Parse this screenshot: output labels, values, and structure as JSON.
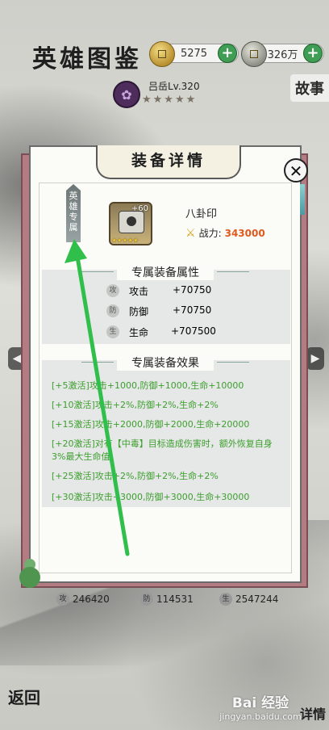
{
  "header": {
    "title": "英雄图鉴",
    "gold": "5275",
    "coins": "326万",
    "plus": "+",
    "story": "故事"
  },
  "hero": {
    "name": "吕岳Lv.320",
    "stars": "★★★★★"
  },
  "dialog": {
    "title": "装备详情",
    "close": "✕",
    "exclusive_tag": "英雄专属",
    "item": {
      "name": "八卦印",
      "level": "+60",
      "stars": "★★★★★",
      "power_label": "战力:",
      "power_value": "343000"
    },
    "attrs_header": "专属装备属性",
    "attrs": [
      {
        "icon": "攻",
        "name": "攻击",
        "value": "+70750"
      },
      {
        "icon": "防",
        "name": "防御",
        "value": "+70750"
      },
      {
        "icon": "生",
        "name": "生命",
        "value": "+707500"
      }
    ],
    "effects_header": "专属装备效果",
    "effects": [
      "[+5激活]攻击+1000,防御+1000,生命+10000",
      "[+10激活]攻击+2%,防御+2%,生命+2%",
      "[+15激活]攻击+2000,防御+2000,生命+20000",
      "[+20激活]对有【中毒】目标造成伤害时，额外恢复自身3%最大生命值",
      "[+25激活]攻击+2%,防御+2%,生命+2%",
      "[+30激活]攻击+3000,防御+3000,生命+30000"
    ]
  },
  "bottom_stats": {
    "attack": "246420",
    "defense": "114531",
    "hp": "2547244"
  },
  "nav": {
    "back": "返回",
    "detail": "详情",
    "left_arrow": "◀",
    "right_arrow": "▶"
  },
  "watermark": {
    "main": "Bai 经验",
    "sub": "jingyan.baidu.com"
  },
  "colors": {
    "accent_green": "#3d9e2e",
    "power_orange": "#e0591d",
    "frame_pink": "#b37c82"
  }
}
